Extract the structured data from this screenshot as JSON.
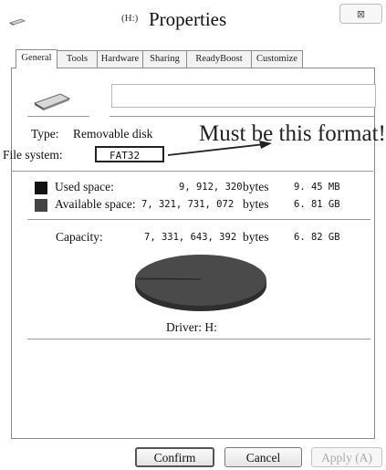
{
  "window": {
    "title_prefix": "(H:)",
    "title": "Properties",
    "close_glyph": "⊠"
  },
  "tabs": [
    {
      "label": "General",
      "active": true
    },
    {
      "label": "Tools",
      "active": false
    },
    {
      "label": "Hardware",
      "active": false
    },
    {
      "label": "Sharing",
      "active": false
    },
    {
      "label": "ReadyBoost",
      "active": false
    },
    {
      "label": "Customize",
      "active": false
    }
  ],
  "general": {
    "drive_name_value": "",
    "type_label": "Type:",
    "type_value": "Removable disk",
    "filesystem_label": "File system:",
    "filesystem_value": "FAT32",
    "annotation": "Must be this format!",
    "used": {
      "label": "Used space:",
      "bytes": "9, 912, 320",
      "unit": "bytes",
      "size": "9. 45 MB",
      "color": "#111111"
    },
    "available": {
      "label": "Available space:",
      "bytes": "7, 321, 731, 072",
      "unit": "bytes",
      "size": "6. 81 GB",
      "color": "#444444"
    },
    "capacity": {
      "label": "Capacity:",
      "bytes": "7, 331, 643, 392",
      "unit": "bytes",
      "size": "6. 82 GB"
    },
    "used_fraction": 0.0014,
    "drive_label": "Driver: H:"
  },
  "buttons": {
    "confirm": "Confirm",
    "cancel": "Cancel",
    "apply": "Apply (A)"
  },
  "icons": {
    "app": "drive-icon",
    "close": "close-icon",
    "drive": "removable-disk-icon"
  }
}
